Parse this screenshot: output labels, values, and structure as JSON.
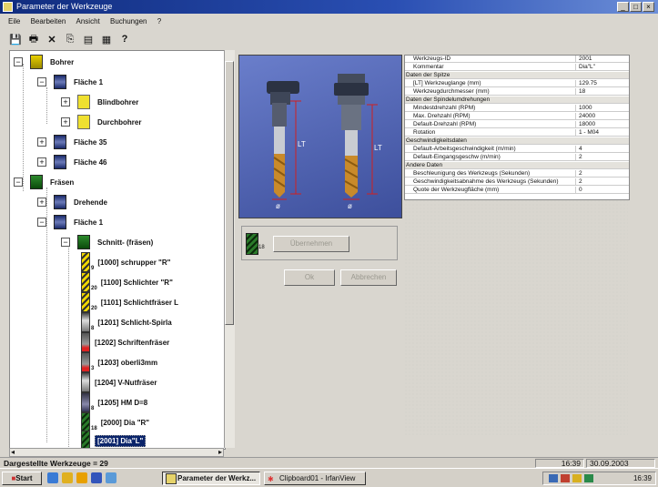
{
  "window": {
    "title": "Parameter der Werkzeuge",
    "controls": [
      "_",
      "□",
      "×"
    ]
  },
  "menu": [
    "Eile",
    "Bearbeiten",
    "Ansicht",
    "Buchungen",
    "?"
  ],
  "toolbar": [
    "save-icon",
    "print-icon",
    "delete-icon",
    "copy-icon",
    "paste-icon",
    "properties-icon",
    "help-icon"
  ],
  "tree": {
    "rows": [
      {
        "label": "Bohrer",
        "pm": "−",
        "icon": "drill"
      },
      {
        "label": "Fläche 1",
        "pm": "−",
        "icon": "face"
      },
      {
        "label": "Blindbohrer",
        "pm": "+",
        "icon": "yellow"
      },
      {
        "label": "Durchbohrer",
        "pm": "+",
        "icon": "yellow"
      },
      {
        "label": "Fläche 35",
        "pm": "+",
        "icon": "face"
      },
      {
        "label": "Fläche 46",
        "pm": "+",
        "icon": "face"
      },
      {
        "label": "Fräsen",
        "pm": "−",
        "icon": "mill"
      },
      {
        "label": "Drehende",
        "pm": "+",
        "icon": "face"
      },
      {
        "label": "Fläche 1",
        "pm": "−",
        "icon": "face"
      },
      {
        "label": "Schnitt- (fräsen)",
        "pm": "−",
        "icon": "mill"
      },
      {
        "label": "[1000] schrupper \"R\"",
        "sub": "9",
        "icon": "tool-yellow"
      },
      {
        "label": "[1100] Schlichter \"R\"",
        "sub": "20",
        "icon": "tool-yellow"
      },
      {
        "label": "[1101] Schlichtfräser L",
        "sub": "20",
        "icon": "tool-yellow"
      },
      {
        "label": "[1201] Schlicht-Spirla",
        "sub": "8",
        "icon": "tool"
      },
      {
        "label": "[1202] Schriftenfräser",
        "sub": "",
        "icon": "tool-red"
      },
      {
        "label": "[1203] oberli3mm",
        "sub": "3",
        "icon": "tool-red"
      },
      {
        "label": "[1204] V-Nutfräser",
        "sub": "",
        "icon": "tool"
      },
      {
        "label": "[1205] HM D=8",
        "sub": "8",
        "icon": "tool-blue"
      },
      {
        "label": "[2000] Dia \"R\"",
        "sub": "18",
        "icon": "tool-green"
      },
      {
        "label": "[2001] Dia\"L\"",
        "sub": "",
        "icon": "tool-green",
        "selected": true
      }
    ]
  },
  "preview": {
    "label_lt": "LT",
    "label_d": "ø"
  },
  "actions": {
    "current_sub": "18",
    "apply": "Übernehmen",
    "ok": "Ok",
    "cancel": "Abbrechen"
  },
  "properties": [
    {
      "key": "Werkzeugs-ID",
      "value": "2001"
    },
    {
      "key": "Kommentar",
      "value": "Dia\"L\""
    },
    {
      "cat": "Daten der Spitze"
    },
    {
      "key": "[LT] Werkzeuglange (mm)",
      "value": "129.75"
    },
    {
      "key": "Werkzeugdurchmesser (mm)",
      "value": "18"
    },
    {
      "cat": "Daten der Spindelumdrehungen"
    },
    {
      "key": "Mindestdrehzahl (RPM)",
      "value": "1000"
    },
    {
      "key": "Max. Drehzahl (RPM)",
      "value": "24000"
    },
    {
      "key": "Default-Drehzahl (RPM)",
      "value": "18000"
    },
    {
      "key": "Rotation",
      "value": "1 - M04"
    },
    {
      "cat": "Geschwindigkeitsdaten"
    },
    {
      "key": "Default-Arbeitsgeschwindigkeit (m/min)",
      "value": "4"
    },
    {
      "key": "Default-Eingangsgeschw (m/min)",
      "value": "2"
    },
    {
      "cat": "Andere Daten"
    },
    {
      "key": "Beschleunigung des Werkzeugs (Sekunden)",
      "value": "2"
    },
    {
      "key": "Geschwindigkeitsabnahme des Werkzeugs (Sekunden)",
      "value": "2"
    },
    {
      "key": "Quote der Werkzeugfläche (mm)",
      "value": "0"
    }
  ],
  "status": {
    "left": "Dargestellte Werkzeuge = 29",
    "time": "16:39",
    "date": "30.09.2003"
  },
  "taskbar": {
    "start": "Start",
    "tasks": [
      "Parameter der Werkz...",
      "Clipboard01 - IrfanView"
    ],
    "clock": "16:39"
  }
}
